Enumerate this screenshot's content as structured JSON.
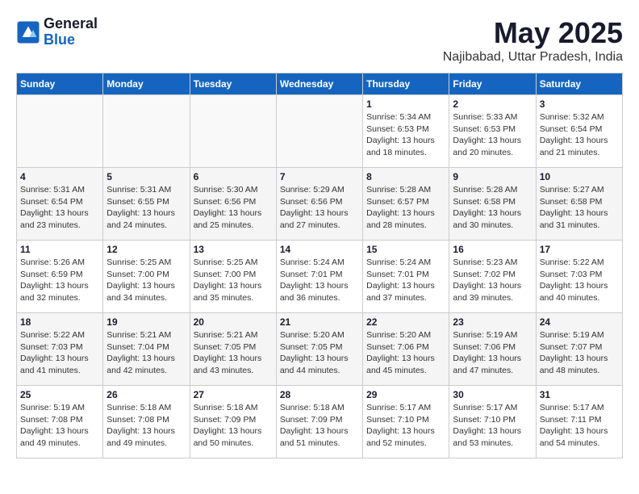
{
  "header": {
    "logo_general": "General",
    "logo_blue": "Blue",
    "month_title": "May 2025",
    "location": "Najibabad, Uttar Pradesh, India"
  },
  "weekdays": [
    "Sunday",
    "Monday",
    "Tuesday",
    "Wednesday",
    "Thursday",
    "Friday",
    "Saturday"
  ],
  "weeks": [
    [
      {
        "day": "",
        "info": ""
      },
      {
        "day": "",
        "info": ""
      },
      {
        "day": "",
        "info": ""
      },
      {
        "day": "",
        "info": ""
      },
      {
        "day": "1",
        "info": "Sunrise: 5:34 AM\nSunset: 6:53 PM\nDaylight: 13 hours\nand 18 minutes."
      },
      {
        "day": "2",
        "info": "Sunrise: 5:33 AM\nSunset: 6:53 PM\nDaylight: 13 hours\nand 20 minutes."
      },
      {
        "day": "3",
        "info": "Sunrise: 5:32 AM\nSunset: 6:54 PM\nDaylight: 13 hours\nand 21 minutes."
      }
    ],
    [
      {
        "day": "4",
        "info": "Sunrise: 5:31 AM\nSunset: 6:54 PM\nDaylight: 13 hours\nand 23 minutes."
      },
      {
        "day": "5",
        "info": "Sunrise: 5:31 AM\nSunset: 6:55 PM\nDaylight: 13 hours\nand 24 minutes."
      },
      {
        "day": "6",
        "info": "Sunrise: 5:30 AM\nSunset: 6:56 PM\nDaylight: 13 hours\nand 25 minutes."
      },
      {
        "day": "7",
        "info": "Sunrise: 5:29 AM\nSunset: 6:56 PM\nDaylight: 13 hours\nand 27 minutes."
      },
      {
        "day": "8",
        "info": "Sunrise: 5:28 AM\nSunset: 6:57 PM\nDaylight: 13 hours\nand 28 minutes."
      },
      {
        "day": "9",
        "info": "Sunrise: 5:28 AM\nSunset: 6:58 PM\nDaylight: 13 hours\nand 30 minutes."
      },
      {
        "day": "10",
        "info": "Sunrise: 5:27 AM\nSunset: 6:58 PM\nDaylight: 13 hours\nand 31 minutes."
      }
    ],
    [
      {
        "day": "11",
        "info": "Sunrise: 5:26 AM\nSunset: 6:59 PM\nDaylight: 13 hours\nand 32 minutes."
      },
      {
        "day": "12",
        "info": "Sunrise: 5:25 AM\nSunset: 7:00 PM\nDaylight: 13 hours\nand 34 minutes."
      },
      {
        "day": "13",
        "info": "Sunrise: 5:25 AM\nSunset: 7:00 PM\nDaylight: 13 hours\nand 35 minutes."
      },
      {
        "day": "14",
        "info": "Sunrise: 5:24 AM\nSunset: 7:01 PM\nDaylight: 13 hours\nand 36 minutes."
      },
      {
        "day": "15",
        "info": "Sunrise: 5:24 AM\nSunset: 7:01 PM\nDaylight: 13 hours\nand 37 minutes."
      },
      {
        "day": "16",
        "info": "Sunrise: 5:23 AM\nSunset: 7:02 PM\nDaylight: 13 hours\nand 39 minutes."
      },
      {
        "day": "17",
        "info": "Sunrise: 5:22 AM\nSunset: 7:03 PM\nDaylight: 13 hours\nand 40 minutes."
      }
    ],
    [
      {
        "day": "18",
        "info": "Sunrise: 5:22 AM\nSunset: 7:03 PM\nDaylight: 13 hours\nand 41 minutes."
      },
      {
        "day": "19",
        "info": "Sunrise: 5:21 AM\nSunset: 7:04 PM\nDaylight: 13 hours\nand 42 minutes."
      },
      {
        "day": "20",
        "info": "Sunrise: 5:21 AM\nSunset: 7:05 PM\nDaylight: 13 hours\nand 43 minutes."
      },
      {
        "day": "21",
        "info": "Sunrise: 5:20 AM\nSunset: 7:05 PM\nDaylight: 13 hours\nand 44 minutes."
      },
      {
        "day": "22",
        "info": "Sunrise: 5:20 AM\nSunset: 7:06 PM\nDaylight: 13 hours\nand 45 minutes."
      },
      {
        "day": "23",
        "info": "Sunrise: 5:19 AM\nSunset: 7:06 PM\nDaylight: 13 hours\nand 47 minutes."
      },
      {
        "day": "24",
        "info": "Sunrise: 5:19 AM\nSunset: 7:07 PM\nDaylight: 13 hours\nand 48 minutes."
      }
    ],
    [
      {
        "day": "25",
        "info": "Sunrise: 5:19 AM\nSunset: 7:08 PM\nDaylight: 13 hours\nand 49 minutes."
      },
      {
        "day": "26",
        "info": "Sunrise: 5:18 AM\nSunset: 7:08 PM\nDaylight: 13 hours\nand 49 minutes."
      },
      {
        "day": "27",
        "info": "Sunrise: 5:18 AM\nSunset: 7:09 PM\nDaylight: 13 hours\nand 50 minutes."
      },
      {
        "day": "28",
        "info": "Sunrise: 5:18 AM\nSunset: 7:09 PM\nDaylight: 13 hours\nand 51 minutes."
      },
      {
        "day": "29",
        "info": "Sunrise: 5:17 AM\nSunset: 7:10 PM\nDaylight: 13 hours\nand 52 minutes."
      },
      {
        "day": "30",
        "info": "Sunrise: 5:17 AM\nSunset: 7:10 PM\nDaylight: 13 hours\nand 53 minutes."
      },
      {
        "day": "31",
        "info": "Sunrise: 5:17 AM\nSunset: 7:11 PM\nDaylight: 13 hours\nand 54 minutes."
      }
    ]
  ]
}
